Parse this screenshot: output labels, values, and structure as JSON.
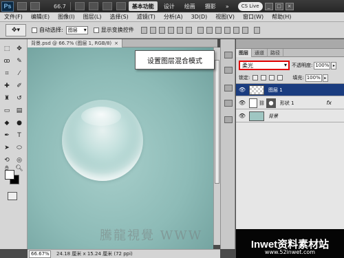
{
  "app": {
    "logo": "Ps",
    "zoom": "66.7",
    "workspaces": [
      "基本功能",
      "设计",
      "绘画",
      "摄影"
    ],
    "more": "»",
    "cs_live": "CS Live"
  },
  "menu": [
    "文件(F)",
    "编辑(E)",
    "图像(I)",
    "图层(L)",
    "选择(S)",
    "滤镜(T)",
    "分析(A)",
    "3D(D)",
    "视图(V)",
    "窗口(W)",
    "帮助(H)"
  ],
  "options": {
    "auto_select_label": "自动选择:",
    "auto_select_value": "图层",
    "show_transform_label": "显示变换控件"
  },
  "document": {
    "tab_label": "背景.psd @ 66.7% (图层 1, RGB/8)",
    "close": "×",
    "watermark": "騰龍視覺 WWW"
  },
  "status": {
    "zoom": "66.67%",
    "info": "24.18 厘米 x 15.24 厘米 (72 ppi)"
  },
  "callout": {
    "text": "设置图层混合模式"
  },
  "layers_panel": {
    "tabs": [
      "图层",
      "通道",
      "路径"
    ],
    "blend_mode": "柔光",
    "opacity_label": "不透明度:",
    "opacity_value": "100%",
    "lock_label": "锁定:",
    "fill_label": "填充:",
    "fill_value": "100%",
    "layers": [
      {
        "name": "图层 1",
        "selected": true,
        "thumb": "checker"
      },
      {
        "name": "形状 1",
        "selected": false,
        "thumb": "shape",
        "fx": "fx"
      },
      {
        "name": "背景",
        "selected": false,
        "thumb": "teal"
      }
    ]
  },
  "brand": {
    "text": "Inwet资料素材站",
    "url": "www.52inwet.com"
  },
  "colors": {
    "selected_layer": "#1a3c7f",
    "highlight_border": "#e10000",
    "canvas": "#8dbbb7"
  }
}
